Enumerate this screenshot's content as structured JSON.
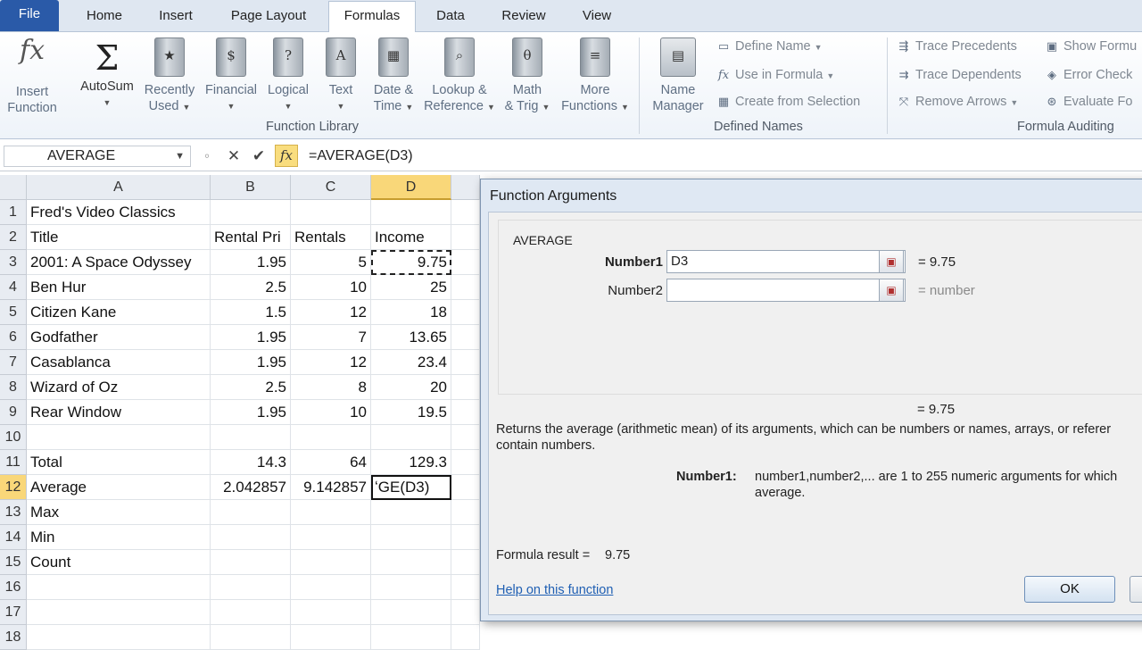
{
  "tabs": [
    {
      "label": "File"
    },
    {
      "label": "Home"
    },
    {
      "label": "Insert"
    },
    {
      "label": "Page Layout"
    },
    {
      "label": "Formulas"
    },
    {
      "label": "Data"
    },
    {
      "label": "Review"
    },
    {
      "label": "View"
    }
  ],
  "ribbon": {
    "function_library": {
      "group_label": "Function Library",
      "insert_function": {
        "line1": "Insert",
        "line2": "Function"
      },
      "autosum": {
        "label": "AutoSum"
      },
      "recently_used": {
        "line1": "Recently",
        "line2": "Used"
      },
      "financial": {
        "label": "Financial"
      },
      "logical": {
        "label": "Logical"
      },
      "text": {
        "label": "Text"
      },
      "date_time": {
        "line1": "Date &",
        "line2": "Time"
      },
      "lookup_reference": {
        "line1": "Lookup &",
        "line2": "Reference"
      },
      "math_trig": {
        "line1": "Math",
        "line2": "& Trig"
      },
      "more_functions": {
        "line1": "More",
        "line2": "Functions"
      }
    },
    "defined_names": {
      "group_label": "Defined Names",
      "name_manager": {
        "line1": "Name",
        "line2": "Manager"
      },
      "define_name": "Define Name",
      "use_in_formula": "Use in Formula",
      "create_from_selection": "Create from Selection"
    },
    "formula_auditing": {
      "group_label": "Formula Auditing",
      "trace_precedents": "Trace Precedents",
      "trace_dependents": "Trace Dependents",
      "remove_arrows": "Remove Arrows",
      "show_formulas": "Show Formu",
      "error_checking": "Error Check",
      "evaluate_formula": "Evaluate Fo"
    }
  },
  "formula_bar": {
    "name_box": "AVERAGE",
    "formula": "=AVERAGE(D3)"
  },
  "columns": [
    "A",
    "B",
    "C",
    "D"
  ],
  "rows": [
    {
      "n": "1",
      "a": "Fred's Video Classics",
      "b": "",
      "c": "",
      "d": ""
    },
    {
      "n": "2",
      "a": "Title",
      "b": "Rental Pri",
      "c": "Rentals",
      "d": "Income"
    },
    {
      "n": "3",
      "a": "2001: A Space Odyssey",
      "b": "1.95",
      "c": "5",
      "d": "9.75"
    },
    {
      "n": "4",
      "a": "Ben Hur",
      "b": "2.5",
      "c": "10",
      "d": "25"
    },
    {
      "n": "5",
      "a": "Citizen Kane",
      "b": "1.5",
      "c": "12",
      "d": "18"
    },
    {
      "n": "6",
      "a": "Godfather",
      "b": "1.95",
      "c": "7",
      "d": "13.65"
    },
    {
      "n": "7",
      "a": "Casablanca",
      "b": "1.95",
      "c": "12",
      "d": "23.4"
    },
    {
      "n": "8",
      "a": "Wizard of Oz",
      "b": "2.5",
      "c": "8",
      "d": "20"
    },
    {
      "n": "9",
      "a": "Rear Window",
      "b": "1.95",
      "c": "10",
      "d": "19.5"
    },
    {
      "n": "10",
      "a": "",
      "b": "",
      "c": "",
      "d": ""
    },
    {
      "n": "11",
      "a": "Total",
      "b": "14.3",
      "c": "64",
      "d": "129.3"
    },
    {
      "n": "12",
      "a": "Average",
      "b": "2.042857",
      "c": "9.142857",
      "d": "ʻGE(D3)"
    },
    {
      "n": "13",
      "a": "Max",
      "b": "",
      "c": "",
      "d": ""
    },
    {
      "n": "14",
      "a": "Min",
      "b": "",
      "c": "",
      "d": ""
    },
    {
      "n": "15",
      "a": "Count",
      "b": "",
      "c": "",
      "d": ""
    },
    {
      "n": "16",
      "a": "",
      "b": "",
      "c": "",
      "d": ""
    },
    {
      "n": "17",
      "a": "",
      "b": "",
      "c": "",
      "d": ""
    },
    {
      "n": "18",
      "a": "",
      "b": "",
      "c": "",
      "d": ""
    }
  ],
  "dialog": {
    "title": "Function Arguments",
    "function_name": "AVERAGE",
    "number1": {
      "label": "Number1",
      "value": "D3",
      "result": "=  9.75"
    },
    "number2": {
      "label": "Number2",
      "value": "",
      "result": "=  number"
    },
    "overall_result": "=  9.75",
    "description_line1": "Returns the average (arithmetic mean) of its arguments, which can be numbers or names, arrays, or referer",
    "description_line2": "contain numbers.",
    "arg_label": "Number1:",
    "arg_desc_line1": "number1,number2,... are 1 to 255 numeric arguments for which",
    "arg_desc_line2": "average.",
    "formula_result_label": "Formula result =",
    "formula_result_value": "9.75",
    "help_link": "Help on this function",
    "ok_label": "OK"
  }
}
